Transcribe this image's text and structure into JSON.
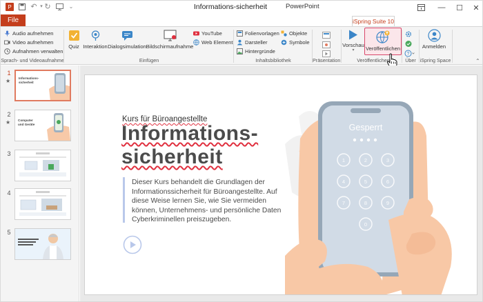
{
  "window": {
    "title": "Informations-sicherheit",
    "app_name": "PowerPoint",
    "controls": [
      "minimize",
      "maximize",
      "close"
    ]
  },
  "quick_access": [
    "save-icon",
    "undo-icon",
    "redo-icon",
    "present-icon",
    "more-icon"
  ],
  "tabs": {
    "file": "File",
    "ispring": "iSpring Suite 10"
  },
  "ribbon": {
    "record": {
      "audio": "Audio aufnehmen",
      "video": "Video aufnehmen",
      "manage": "Aufnahmen verwalten",
      "group": "Sprach- und Videoaufnahme"
    },
    "insert": {
      "quiz": "Quiz",
      "interaction": "Interaktion",
      "dialog": "Dialogsimulation",
      "screen": "Bildschirmaufnahme",
      "youtube": "YouTube",
      "web": "Web Element",
      "group": "Einfügen"
    },
    "library": {
      "templates": "Folienvorlagen",
      "actors": "Darsteller",
      "backgrounds": "Hintergründe",
      "objects": "Objekte",
      "symbols": "Symbole",
      "group": "Inhaltsbibliothek"
    },
    "presentation": {
      "group": "Präsentation"
    },
    "publish": {
      "preview": "Vorschau",
      "publish": "Veröffentlichen",
      "group": "Veröffentlichen"
    },
    "about": {
      "group": "Über"
    },
    "space": {
      "login": "Anmelden",
      "group": "iSpring Space"
    },
    "colors": {
      "accent": "#c43e1c",
      "highlight_border": "#d9466a",
      "highlight_fill": "#fbe6ea"
    }
  },
  "thumbnails": [
    {
      "number": "1",
      "star": "★",
      "selected": true,
      "title": "Informations-sicherheit"
    },
    {
      "number": "2",
      "star": "★",
      "selected": false,
      "title": "Computer und Geräte"
    },
    {
      "number": "3",
      "star": "",
      "selected": false,
      "title": ""
    },
    {
      "number": "4",
      "star": "",
      "selected": false,
      "title": ""
    },
    {
      "number": "5",
      "star": "",
      "selected": false,
      "title": ""
    }
  ],
  "slide": {
    "kicker": "Kurs für Büroangestellte",
    "title_line1": "Informations-",
    "title_line2": "sicherheit",
    "description": "Dieser Kurs behandelt die Grundlagen der Informationssicherheit für Büroangestellte. Auf diese Weise lernen Sie, wie Sie vermeiden können, Unternehmens- und persönliche Daten Cyberkriminellen preiszugeben.",
    "phone_lock_text": "Gesperrt"
  }
}
